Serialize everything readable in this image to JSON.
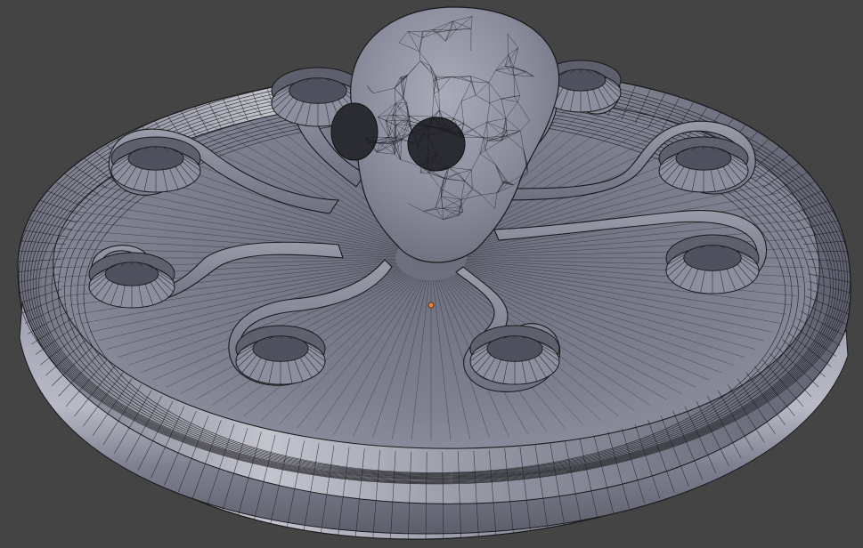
{
  "viewport": {
    "background_color": "#444444",
    "shading_mode": "solid-wireframe",
    "object": "octopus-on-round-base",
    "surface_color": "#8a8c9c",
    "edge_color": "#1a1a1e",
    "origin_marker_color": "#f08030"
  }
}
